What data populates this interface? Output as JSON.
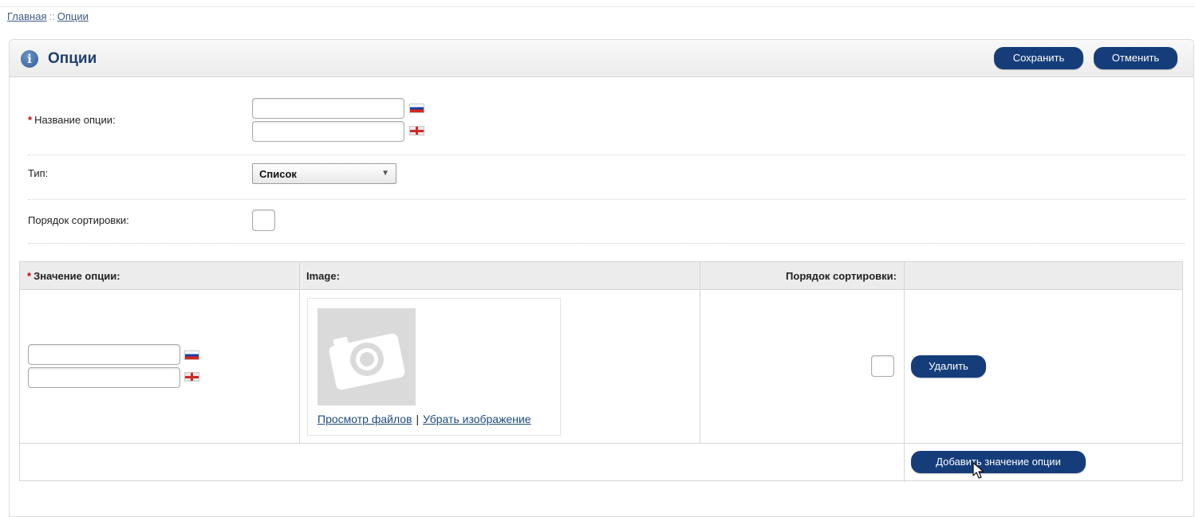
{
  "breadcrumb": {
    "home": "Главная",
    "separator": "::",
    "current": "Опции"
  },
  "panel": {
    "title": "Опции",
    "buttons": {
      "save": "Сохранить",
      "cancel": "Отменить"
    }
  },
  "form": {
    "option_name": {
      "required_mark": "*",
      "label": "Название опции:",
      "value_ru": "",
      "value_en": ""
    },
    "type": {
      "label": "Тип:",
      "selected": "Список"
    },
    "sort_order": {
      "label": "Порядок сортировки:",
      "value": ""
    }
  },
  "values_table": {
    "headers": {
      "required_mark": "*",
      "value": "Значение опции:",
      "image": "Image:",
      "sort_order": "Порядок сортировки:"
    },
    "rows": [
      {
        "value_ru": "",
        "value_en": "",
        "image_links": {
          "browse": "Просмотр файлов",
          "separator": "|",
          "remove": "Убрать изображение"
        },
        "sort_order": "",
        "delete_label": "Удалить"
      }
    ],
    "add_label": "Добавить значение опции"
  },
  "colors": {
    "button": "#153d7a",
    "title": "#1f3f6e",
    "header_bg": "#ececec",
    "required": "#cc0000"
  },
  "icons": [
    "info-icon",
    "flag-ru-icon",
    "flag-en-icon",
    "dropdown-arrow-icon",
    "camera-placeholder-icon",
    "mouse-cursor-icon"
  ]
}
